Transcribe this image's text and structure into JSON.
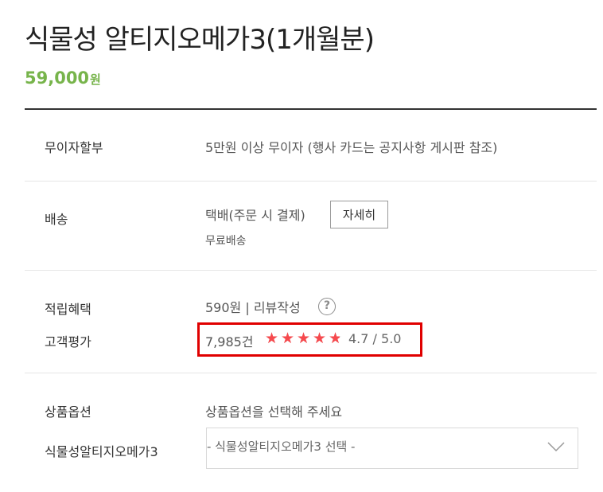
{
  "product": {
    "title": "식물성 알티지오메가3(1개월분)",
    "price": "59,000",
    "price_unit": "원"
  },
  "installment": {
    "label": "무이자할부",
    "value": "5만원 이상 무이자 (행사 카드는 공지사항 게시판 참조)"
  },
  "shipping": {
    "label": "배송",
    "value": "택배(주문 시 결제)",
    "detail_button": "자세히",
    "fee": "무료배송"
  },
  "points": {
    "label": "적립혜택",
    "value": "590원 | 리뷰작성",
    "help_icon": "question-circle-icon",
    "help_glyph": "?"
  },
  "review": {
    "label": "고객평가",
    "count": "7,985건",
    "rating": 4.7,
    "rating_text": "4.7 / 5.0",
    "star_color": "#f6494d",
    "highlight_color": "#e00000"
  },
  "options": {
    "label": "상품옵션",
    "value": "상품옵션을 선택해 주세요",
    "item_label": "식물성알티지오메가3",
    "select_value": "- 식물성알티지오메가3 선택 -",
    "select_icon": "chevron-down-icon"
  },
  "colors": {
    "price": "#77b44b",
    "divider": "#333333"
  }
}
